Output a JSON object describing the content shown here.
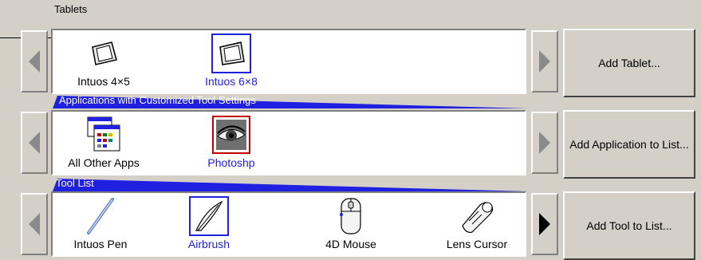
{
  "sections": {
    "tablets": {
      "title": "Tablets",
      "items": [
        {
          "label": "Intuos 4×5",
          "icon": "tablet-small-icon",
          "selected": false
        },
        {
          "label": "Intuos 6×8",
          "icon": "tablet-large-icon",
          "selected": true
        }
      ],
      "add_button": "Add Tablet..."
    },
    "applications": {
      "title": "Applications with Customized Tool Settings",
      "items": [
        {
          "label": "All Other Apps",
          "icon": "app-windows-icon",
          "selected": false
        },
        {
          "label": "Photoshp",
          "icon": "eye-icon",
          "selected": true
        }
      ],
      "add_button": "Add Application to List..."
    },
    "tools": {
      "title": "Tool List",
      "items": [
        {
          "label": "Intuos Pen",
          "icon": "pen-icon",
          "selected": false
        },
        {
          "label": "Airbrush",
          "icon": "airbrush-icon",
          "selected": true
        },
        {
          "label": "4D Mouse",
          "icon": "mouse-icon",
          "selected": false
        },
        {
          "label": "Lens Cursor",
          "icon": "lens-cursor-icon",
          "selected": false
        }
      ],
      "add_button": "Add Tool to List..."
    }
  },
  "colors": {
    "background": "#d4d0c8",
    "selection": "#2020e0",
    "title_bar": "#2020e0"
  }
}
